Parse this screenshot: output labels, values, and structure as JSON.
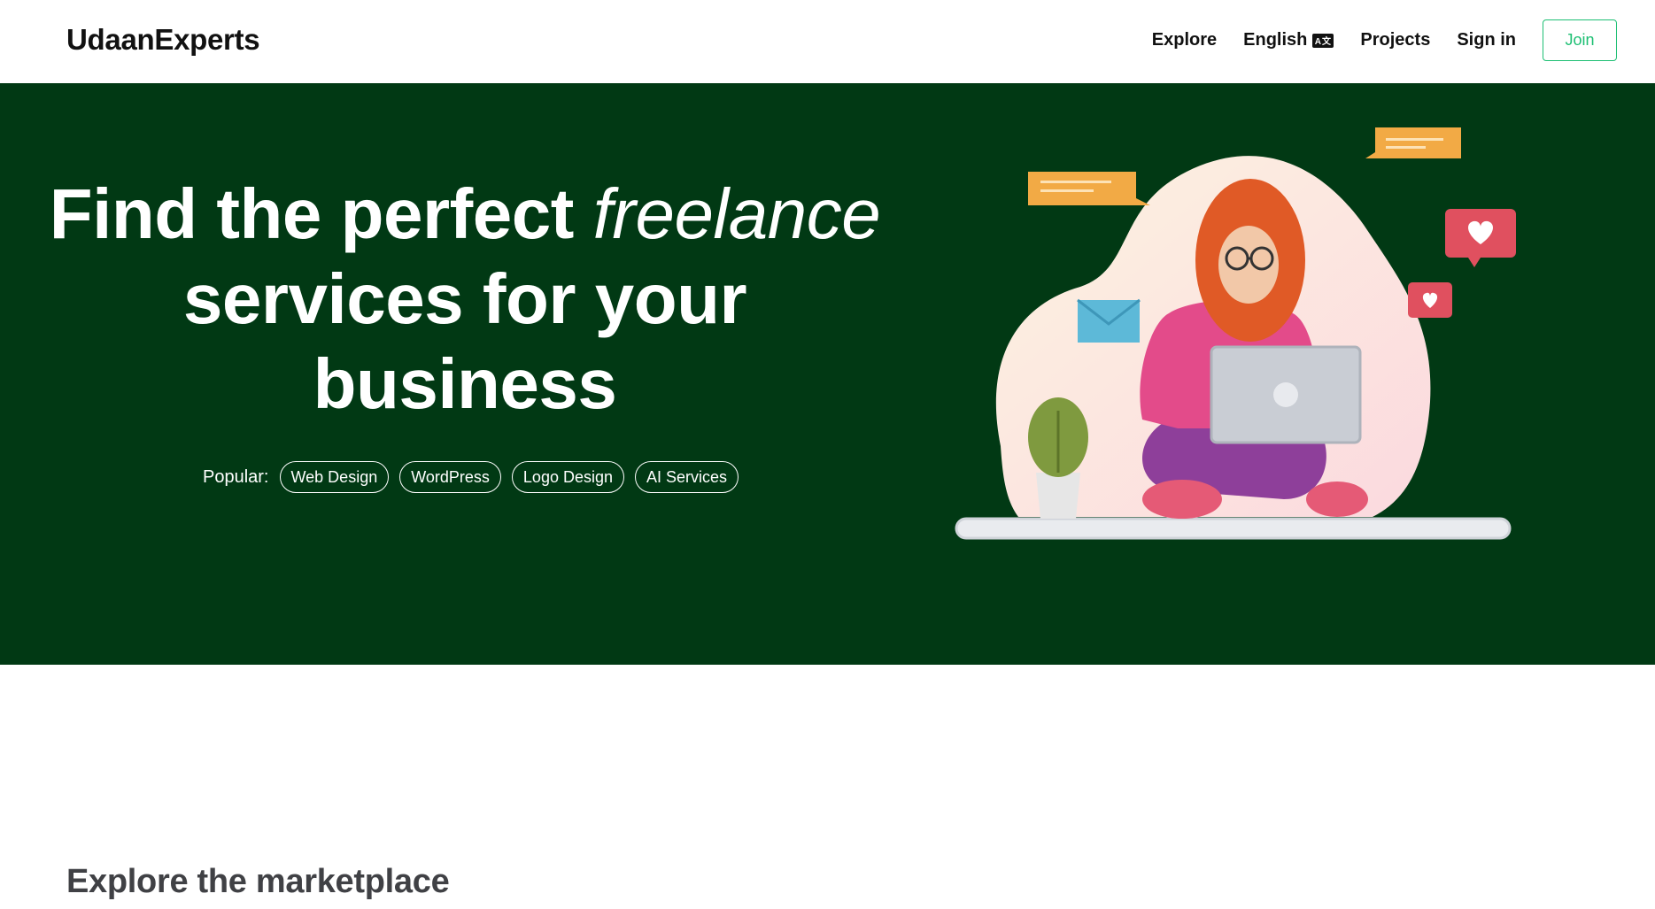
{
  "brand": {
    "name": "UdaanExperts"
  },
  "nav": {
    "explore": "Explore",
    "language": "English",
    "language_icon_text": "A文",
    "projects": "Projects",
    "sign_in": "Sign in",
    "join": "Join"
  },
  "hero": {
    "title_part1": "Find the perfect",
    "title_italic": "freelance",
    "title_line2": "services for your",
    "title_line3": "business",
    "popular_label": "Popular:",
    "popular_tags": [
      "Web Design",
      "WordPress",
      "Logo Design",
      "AI Services"
    ],
    "background_color": "#013914"
  },
  "marketplace": {
    "title": "Explore the marketplace"
  },
  "colors": {
    "accent": "#1dbf73",
    "hero_bg": "#013914",
    "text_dark": "#111111",
    "heading_gray": "#404145"
  },
  "icons": [
    "language-icon",
    "freelancer-illustration",
    "chat-bubble-icon",
    "mail-icon",
    "heart-icon"
  ]
}
